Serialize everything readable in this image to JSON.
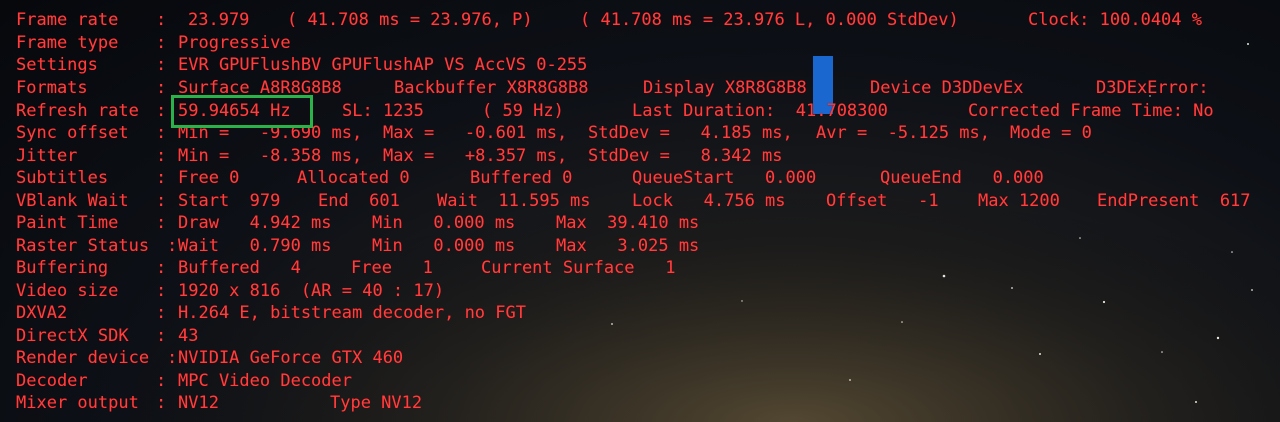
{
  "colors": {
    "text": "#ff3f3f",
    "highlight_box": "#2bb34a",
    "marker": "#1a6fe0"
  },
  "stats": {
    "frame_rate": {
      "label": "Frame rate",
      "value": "23.979",
      "detail1": "( 41.708 ms = 23.976, P)",
      "detail2": "( 41.708 ms = 23.976 L, 0.000 StdDev)",
      "clock": "Clock: 100.0404 %"
    },
    "frame_type": {
      "label": "Frame type",
      "value": "Progressive"
    },
    "settings": {
      "label": "Settings",
      "value": "EVR GPUFlushBV GPUFlushAP VS AccVS 0-255"
    },
    "formats": {
      "label": "Formats",
      "surface": "Surface A8R8G8B8",
      "backbuffer": "Backbuffer X8R8G8B8",
      "display": "Display X8R8G8B8",
      "device": "Device D3DDevEx",
      "error": "D3DExError:"
    },
    "refresh_rate": {
      "label": "Refresh rate",
      "value": "59.94654 Hz",
      "sl": "SL: 1235",
      "hz": "( 59 Hz)",
      "last_duration": "Last Duration:  41.708300",
      "corrected": "Corrected Frame Time: No"
    },
    "sync_offset": {
      "label": "Sync offset",
      "min": "Min =   -9.690 ms,",
      "max": "Max =   -0.601 ms,",
      "stddev": "StdDev =   4.185 ms,",
      "avr": "Avr =  -5.125 ms,",
      "mode": "Mode = 0"
    },
    "jitter": {
      "label": "Jitter",
      "min": "Min =   -8.358 ms,",
      "max": "Max =   +8.357 ms,",
      "stddev": "StdDev =   8.342 ms"
    },
    "subtitles": {
      "label": "Subtitles",
      "free": "Free 0",
      "allocated": "Allocated 0",
      "buffered": "Buffered 0",
      "queue_start": "QueueStart   0.000",
      "queue_end": "QueueEnd   0.000"
    },
    "vblank_wait": {
      "label": "VBlank Wait",
      "start": "Start  979",
      "end": "End  601",
      "wait": "Wait  11.595 ms",
      "lock": "Lock   4.756 ms",
      "offset": "Offset   -1",
      "max": "Max 1200",
      "end_present": "EndPresent  617"
    },
    "paint_time": {
      "label": "Paint Time",
      "draw": "Draw   4.942 ms",
      "min": "Min   0.000 ms",
      "max": "Max  39.410 ms"
    },
    "raster_status": {
      "label": "Raster Status",
      "wait": "Wait   0.790 ms",
      "min": "Min   0.000 ms",
      "max": "Max   3.025 ms"
    },
    "buffering": {
      "label": "Buffering",
      "buffered": "Buffered   4",
      "free": "Free   1",
      "current_surface": "Current Surface   1"
    },
    "video_size": {
      "label": "Video size",
      "value": "1920 x 816  (AR = 40 : 17)"
    },
    "dxva2": {
      "label": "DXVA2",
      "value": "H.264 E, bitstream decoder, no FGT"
    },
    "directx_sdk": {
      "label": "DirectX SDK",
      "value": "43"
    },
    "render_device": {
      "label": "Render device",
      "value": "NVIDIA GeForce GTX 460"
    },
    "decoder": {
      "label": "Decoder",
      "value": "MPC Video Decoder"
    },
    "mixer_output": {
      "label": "Mixer output",
      "value": "NV12",
      "type": "Type NV12"
    }
  }
}
